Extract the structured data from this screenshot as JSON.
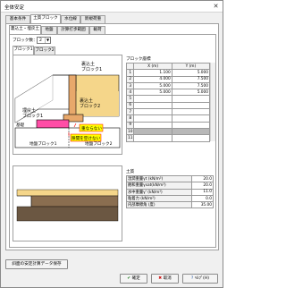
{
  "window": {
    "title": "全体安定",
    "close_icon": "close-icon"
  },
  "main_tabs": [
    {
      "label": "基本条件"
    },
    {
      "label": "土質ブロック"
    },
    {
      "label": "水位線"
    },
    {
      "label": "新規荷重"
    }
  ],
  "sub_tabs": [
    {
      "label": "裏込土・埋戻土"
    },
    {
      "label": "地盤"
    },
    {
      "label": "計算打歩範囲"
    },
    {
      "label": "載荷"
    }
  ],
  "block_count": {
    "label": "ブロック数：",
    "value": "2"
  },
  "block_tabs": [
    {
      "label": "ブロック1"
    },
    {
      "label": "ブロック2"
    }
  ],
  "diagram": {
    "backfill1": "裏込土\nブロック1",
    "backfill2": "裏込土\nブロック2",
    "refill": "埋戻土\nブロック1",
    "base": "基礎",
    "note1": "重ならない",
    "note2": "隙間を空けない",
    "ground1": "地盤ブロック1",
    "ground2": "地盤ブロック2"
  },
  "coords": {
    "title": "ブロック座標",
    "headers": [
      "",
      "X (m)",
      "Y (m)"
    ],
    "rows": [
      [
        "1",
        "1.100",
        "5.000"
      ],
      [
        "2",
        "4.000",
        "7.500"
      ],
      [
        "3",
        "5.000",
        "7.500"
      ],
      [
        "4",
        "5.000",
        "5.000"
      ],
      [
        "5",
        "",
        ""
      ],
      [
        "6",
        "",
        ""
      ],
      [
        "7",
        "",
        ""
      ],
      [
        "8",
        "",
        ""
      ],
      [
        "9",
        "",
        ""
      ],
      [
        "10",
        "",
        ""
      ],
      [
        "11",
        "",
        ""
      ]
    ]
  },
  "soil": {
    "title": "土質",
    "rows": [
      [
        "湿潤重量γt (kN/m³)",
        "20.0"
      ],
      [
        "飽和重量γsat(kN/m³)",
        "20.0"
      ],
      [
        "水中重量γ' (kN/m³)",
        "11.0"
      ],
      [
        "粘着力 (kN/m²)",
        "0.0"
      ],
      [
        "内部摩擦角 (度)",
        "35.00"
      ]
    ]
  },
  "buttons": {
    "save_calc": "斜面の安定計算データ保存",
    "ok": "確定",
    "cancel": "取消",
    "help": "ﾍﾙﾌﾟ(H)"
  },
  "colors": {
    "backfill": "#f5d68a",
    "base_block": "#ff4da6",
    "wall": "#e8a86b",
    "ground": "#6b5742",
    "note": "#ffff00"
  }
}
